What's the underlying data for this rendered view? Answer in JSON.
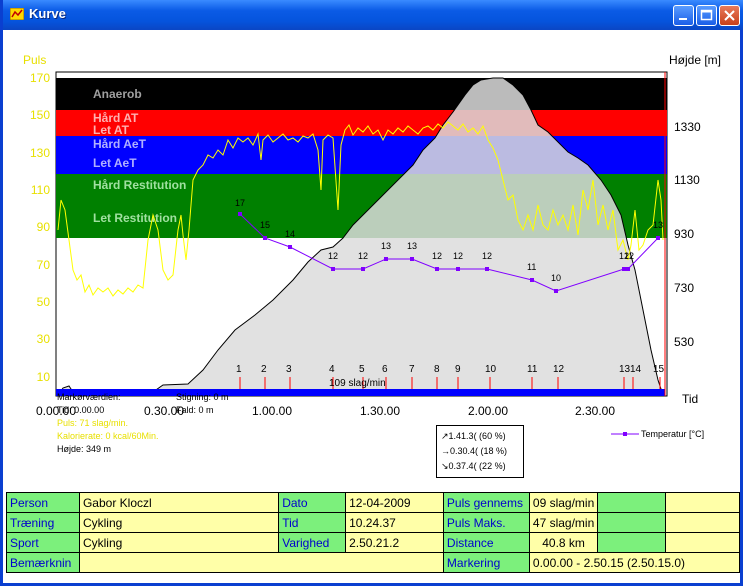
{
  "window": {
    "title": "Kurve"
  },
  "axes": {
    "left_title": "Puls",
    "right_title": "Højde [m]",
    "right_bottom": "Tid",
    "left_ticks": [
      "170",
      "150",
      "130",
      "110",
      "90",
      "70",
      "50",
      "30",
      "10"
    ],
    "right_ticks": [
      "1330",
      "1130",
      "930",
      "730",
      "530"
    ],
    "x_ticks": [
      "0.00.00",
      "0.30.00",
      "1.00.00",
      "1.30.00",
      "2.00.00",
      "2.30.00"
    ]
  },
  "zones": [
    {
      "label": "Anaerob",
      "color": "#000000"
    },
    {
      "label": "Hård AT",
      "color": "#ff0000"
    },
    {
      "label": "Let AT",
      "color": "#ff0000"
    },
    {
      "label": "Hård AeT",
      "color": "#0000ff"
    },
    {
      "label": "Let AeT",
      "color": "#0000ff"
    },
    {
      "label": "Hård Restitution",
      "color": "#008000"
    },
    {
      "label": "Let Restitution",
      "color": "#008000"
    }
  ],
  "temperature": {
    "points": [
      {
        "t": "1:00:00",
        "v": "17"
      },
      {
        "t": "1:06:00",
        "v": "15"
      },
      {
        "t": "1:13:00",
        "v": "14"
      },
      {
        "t": "1:25:00",
        "v": "12"
      },
      {
        "t": "1:33:00",
        "v": "12"
      },
      {
        "t": "1:40:00",
        "v": "13"
      },
      {
        "t": "1:47:00",
        "v": "13"
      },
      {
        "t": "1:54:00",
        "v": "12"
      },
      {
        "t": "2:00:00",
        "v": "12"
      },
      {
        "t": "2:08:00",
        "v": "12"
      },
      {
        "t": "2:20:00",
        "v": "11"
      },
      {
        "t": "2:27:00",
        "v": "10"
      },
      {
        "t": "2:43:00",
        "v": "12"
      },
      {
        "t": "2:45:00",
        "v": "12"
      },
      {
        "t": "2:48:00",
        "v": "13"
      }
    ],
    "legend": "Temperatur [°C]"
  },
  "markers": [
    "1",
    "2",
    "3",
    "4",
    "5",
    "6",
    "7",
    "8",
    "9",
    "10",
    "11",
    "12",
    "13",
    "14",
    "15"
  ],
  "marker_note": "109 slag/min",
  "cursor_info": {
    "title": "Markørværdien:",
    "tid": "Tid: 0.00.00",
    "puls": "Puls: 71 slag/min.",
    "kalorie": "Kalorierate: 0 kcal/60Min.",
    "hojde": "Højde: 349 m",
    "stigning": "Stigning: 0 m",
    "fald": "Fald: 0 m"
  },
  "stats_box": {
    "up": "↗1.41.3( (60 %)",
    "flat": "→0.30.4( (18 %)",
    "down": "↘0.37.4( (22 %)"
  },
  "table": {
    "person_k": "Person",
    "person_v": "Gabor Kloczl",
    "dato_k": "Dato",
    "dato_v": "12-04-2009",
    "pulsg_k": "Puls gennems",
    "pulsg_v": "09 slag/min",
    "traening_k": "Træning",
    "traening_v": "Cykling",
    "tid_k": "Tid",
    "tid_v": "10.24.37",
    "pulsm_k": "Puls Maks.",
    "pulsm_v": "47 slag/min",
    "sport_k": "Sport",
    "sport_v": "Cykling",
    "varighed_k": "Varighed",
    "varighed_v": "2.50.21.2",
    "distance_k": "Distance",
    "distance_v": "40.8 km",
    "bem_k": "Bemærknin",
    "bem_v": "",
    "markering_k": "Markering",
    "markering_v": "0.00.00 - 2.50.15 (2.50.15.0)"
  }
}
